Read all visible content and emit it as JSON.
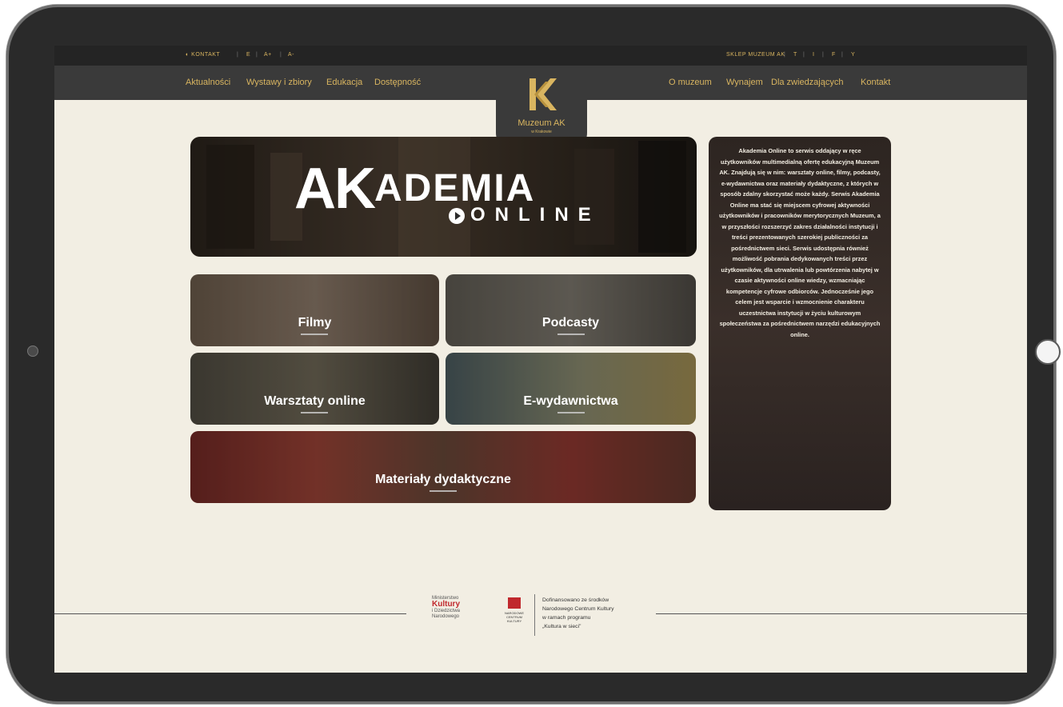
{
  "topbar": {
    "contact": "◐ KONTAKT",
    "lang_1": "E",
    "a_sizes": "A+",
    "a_size_2": "A-",
    "email": "SKLEP MUZEUM AK",
    "social_twitter": "T",
    "social_instagram": "I",
    "social_facebook": "F",
    "social_youtube": "Y"
  },
  "nav_left": [
    "Aktualności",
    "Wystawy i zbiory",
    "Edukacja",
    "Dostępność"
  ],
  "nav_right": [
    "O muzeum",
    "Wynajem",
    "Dla zwiedzających",
    "Kontakt"
  ],
  "logo": {
    "text": "Muzeum AK",
    "sub": "w Krakowie"
  },
  "hero": {
    "title_ak": "AK",
    "title_rest": "ADEMIA",
    "sub": "ONLINE"
  },
  "tiles": [
    {
      "label": "Filmy"
    },
    {
      "label": "Podcasty"
    },
    {
      "label": "Warsztaty online"
    },
    {
      "label": "E-wydawnictwa"
    },
    {
      "label": "Materiały dydaktyczne"
    }
  ],
  "sidebar": {
    "text": "Akademia Online to serwis oddający w ręce użytkowników multimedialną ofertę edukacyjną Muzeum AK. Znajdują się w nim: warsztaty online, filmy, podcasty, e-wydawnictwa oraz materiały dydaktyczne, z których w sposób zdalny skorzystać może każdy. Serwis Akademia Online ma stać się miejscem cyfrowej aktywności użytkowników i pracowników merytorycznych Muzeum, a w przyszłości rozszerzyć zakres działalności instytucji i treści prezentowanych szerokiej publiczności za pośrednictwem sieci. Serwis udostępnia również możliwość pobrania dedykowanych treści przez użytkowników, dla utrwalenia lub powtórzenia nabytej w czasie aktywności online wiedzy, wzmacniając kompetencje cyfrowe odbiorców. Jednocześnie jego celem jest wsparcie i wzmocnienie charakteru uczestnictwa instytucji w życiu kulturowym społeczeństwa za pośrednictwem narzędzi edukacyjnych online."
  },
  "footer": {
    "ministry_1": "Ministerstwo",
    "ministry_2": "Kultury",
    "ministry_3": "i Dziedzictwa Narodowego",
    "nck": "NARODOWE CENTRUM KULTURY",
    "text_1": "Dofinansowano ze środków",
    "text_2": "Narodowego Centrum Kultury",
    "text_3": "w ramach programu",
    "text_4": "„Kultura w sieci”"
  },
  "colors": {
    "gold": "#d9b560",
    "background": "#f2eee3",
    "dark": "#3a3a3a",
    "ministry_red": "#c0282d"
  }
}
